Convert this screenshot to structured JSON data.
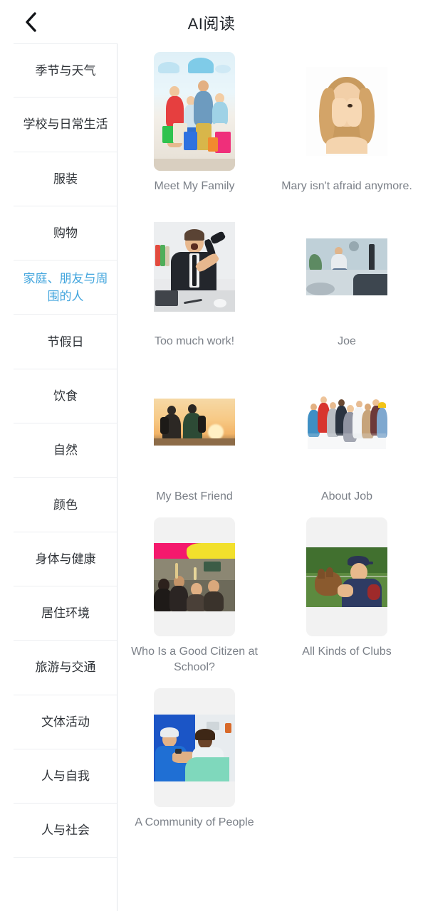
{
  "header": {
    "back_icon": "chevron-left-icon",
    "title": "AI阅读"
  },
  "sidebar": {
    "active_index": 4,
    "items": [
      {
        "label": "季节与天气"
      },
      {
        "label": "学校与日常生活"
      },
      {
        "label": "服装"
      },
      {
        "label": "购物"
      },
      {
        "label": "家庭、朋友与周围的人"
      },
      {
        "label": "节假日"
      },
      {
        "label": "饮食"
      },
      {
        "label": "自然"
      },
      {
        "label": "颜色"
      },
      {
        "label": "身体与健康"
      },
      {
        "label": "居住环境"
      },
      {
        "label": "旅游与交通"
      },
      {
        "label": "文体活动"
      },
      {
        "label": "人与自我"
      },
      {
        "label": "人与社会"
      }
    ]
  },
  "content": {
    "cards": [
      {
        "title": "Meet My Family",
        "fit": "cover",
        "pad_color": "#ffffff"
      },
      {
        "title": "Mary isn't afraid anymore.",
        "fit": "letterbox",
        "pad_color": "#ffffff"
      },
      {
        "title": "Too much work!",
        "fit": "letterbox",
        "pad_color": "#ffffff"
      },
      {
        "title": "Joe",
        "fit": "letterbox",
        "pad_color": "#ffffff"
      },
      {
        "title": "My Best Friend",
        "fit": "letterbox",
        "pad_color": "#ffffff"
      },
      {
        "title": "About Job",
        "fit": "letterbox",
        "pad_color": "#ffffff"
      },
      {
        "title": "Who Is a Good Citizen at School?",
        "fit": "letterbox",
        "pad_color": "#f2f2f2"
      },
      {
        "title": "All Kinds of Clubs",
        "fit": "letterbox",
        "pad_color": "#f2f2f2"
      },
      {
        "title": "A Community of People",
        "fit": "letterbox",
        "pad_color": "#f2f2f2"
      }
    ]
  },
  "colors": {
    "accent": "#42a5dd",
    "title_text": "#1f2329",
    "caption_text": "#7b8088",
    "sidebar_text": "#2f3338",
    "divider": "#eceef1",
    "sidebar_border": "#e3e6ea",
    "letterbox_gray": "#f2f2f2",
    "background": "#ffffff"
  }
}
